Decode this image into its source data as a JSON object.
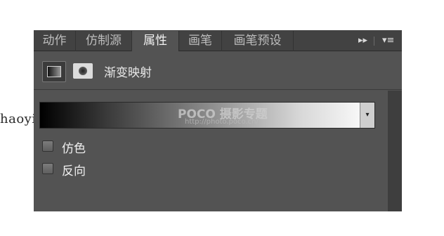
{
  "tabs": [
    {
      "label": "动作",
      "active": false
    },
    {
      "label": "仿制源",
      "active": false
    },
    {
      "label": "属性",
      "active": true
    },
    {
      "label": "画笔",
      "active": false
    },
    {
      "label": "画笔预设",
      "active": false
    }
  ],
  "tabbar_controls": {
    "collapse_glyph": "▸▸",
    "menu_glyph": "▾≡"
  },
  "header": {
    "title": "渐变映射"
  },
  "gradient": {
    "dropdown_glyph": "▾"
  },
  "options": [
    {
      "label": "仿色",
      "checked": false
    },
    {
      "label": "反向",
      "checked": false
    }
  ],
  "watermarks": {
    "site": "haoyidiansheji.com",
    "poco_logo": "POCO 摄影专题",
    "poco_url": "http://photo.poco.cn/"
  },
  "colors": {
    "panel_bg": "#535353",
    "tabbar_bg": "#424242",
    "active_tab_bg": "#535353"
  }
}
